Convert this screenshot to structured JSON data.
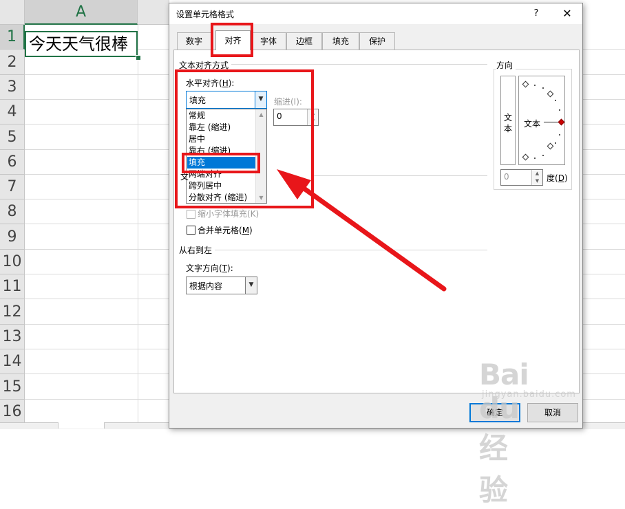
{
  "spreadsheet": {
    "column_a": "A",
    "rows": [
      "1",
      "2",
      "3",
      "4",
      "5",
      "6",
      "7",
      "8",
      "9",
      "10",
      "11",
      "12",
      "13",
      "14",
      "15",
      "16"
    ],
    "a1_value": "今天天气很棒"
  },
  "dialog": {
    "title": "设置单元格格式",
    "help": "?",
    "close": "✕",
    "tabs": [
      "数字",
      "对齐",
      "字体",
      "边框",
      "填充",
      "保护"
    ],
    "active_tab": "对齐",
    "text_alignment_section": "文本对齐方式",
    "horizontal_label": "水平对齐(H):",
    "horizontal_label_main": "水平对齐(",
    "horizontal_label_key": "H",
    "horizontal_label_end": "):",
    "horizontal_value": "填充",
    "horizontal_options": [
      "常规",
      "靠左 (缩进)",
      "居中",
      "靠右 (缩进)",
      "填充",
      "两端对齐",
      "跨列居中",
      "分散对齐 (缩进)"
    ],
    "selected_option": "填充",
    "indent_label": "缩进(I):",
    "indent_value": "0",
    "text_control_partial": "文",
    "shrink_to_fit": "缩小字体填充(K)",
    "merge_cells_main": "合并单元格(",
    "merge_cells_key": "M",
    "merge_cells_end": ")",
    "rtl_section": "从右到左",
    "text_direction_main": "文字方向(",
    "text_direction_key": "T",
    "text_direction_end": "):",
    "text_direction_value": "根据内容",
    "orientation_section": "方向",
    "orientation_vertical_1": "文",
    "orientation_vertical_2": "本",
    "orientation_dial_text": "文本",
    "degrees_value": "0",
    "degrees_main": "度(",
    "degrees_key": "D",
    "degrees_end": ")",
    "ok": "确定",
    "cancel": "取消"
  },
  "watermark": {
    "main": "Bai du 经验",
    "sub": "jingyan.baidu.com"
  },
  "colors": {
    "annotation_red": "#e8161a",
    "selection_blue": "#0078d7",
    "excel_green": "#217346"
  }
}
